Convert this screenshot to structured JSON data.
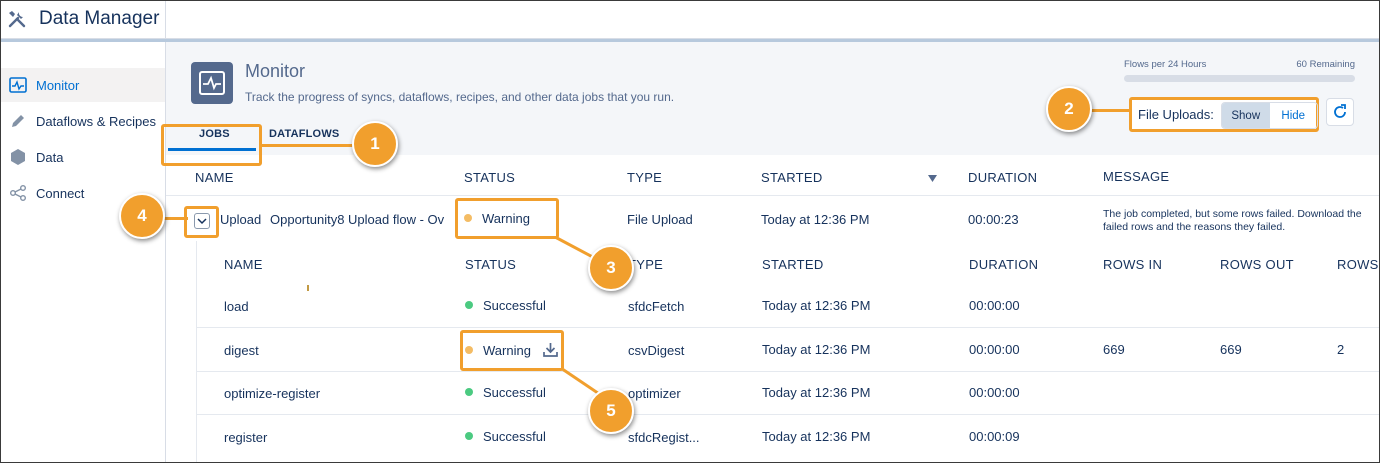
{
  "app": {
    "title": "Data Manager"
  },
  "sidebar": {
    "items": [
      {
        "label": "Monitor",
        "icon": "monitor-icon",
        "active": true
      },
      {
        "label": "Dataflows & Recipes",
        "icon": "pencil-icon",
        "active": false
      },
      {
        "label": "Data",
        "icon": "hexagon-icon",
        "active": false
      },
      {
        "label": "Connect",
        "icon": "share-icon",
        "active": false
      }
    ]
  },
  "header": {
    "title": "Monitor",
    "description": "Track the progress of syncs, dataflows, recipes, and other data jobs that you run.",
    "flows_label": "Flows per 24 Hours",
    "flows_remaining": "60 Remaining",
    "file_uploads_label": "File Uploads:",
    "show_label": "Show",
    "hide_label": "Hide"
  },
  "tabs": [
    {
      "label": "JOBS",
      "active": true
    },
    {
      "label": "DATAFLOWS",
      "active": false
    }
  ],
  "table": {
    "columns": [
      "NAME",
      "STATUS",
      "TYPE",
      "STARTED",
      "DURATION",
      "MESSAGE"
    ],
    "job": {
      "type_label": "Upload",
      "name": "Opportunity8 Upload flow - Ov",
      "status": "Warning",
      "type": "File Upload",
      "started": "Today at 12:36 PM",
      "duration": "00:00:23",
      "message_line1": "The job completed, but some rows failed. Download the",
      "message_line2": "failed rows and the reasons they failed."
    }
  },
  "subtable": {
    "columns": [
      "NAME",
      "STATUS",
      "TYPE",
      "STARTED",
      "DURATION",
      "ROWS IN",
      "ROWS OUT",
      "ROWS"
    ],
    "rows": [
      {
        "name": "load",
        "status": "Successful",
        "type": "sfdcFetch",
        "started": "Today at 12:36 PM",
        "duration": "00:00:00",
        "rows_in": "",
        "rows_out": "",
        "rows": ""
      },
      {
        "name": "digest",
        "status": "Warning",
        "type": "csvDigest",
        "started": "Today at 12:36 PM",
        "duration": "00:00:00",
        "rows_in": "669",
        "rows_out": "669",
        "rows": "2"
      },
      {
        "name": "optimize-register",
        "status": "Successful",
        "type": "optimizer",
        "started": "Today at 12:36 PM",
        "duration": "00:00:00",
        "rows_in": "",
        "rows_out": "",
        "rows": ""
      },
      {
        "name": "register",
        "status": "Successful",
        "type": "sfdcRegist...",
        "started": "Today at 12:36 PM",
        "duration": "00:00:09",
        "rows_in": "",
        "rows_out": "",
        "rows": ""
      }
    ]
  },
  "callouts": [
    "1",
    "2",
    "3",
    "4",
    "5"
  ],
  "colors": {
    "accent": "#f19f2d",
    "brand_blue": "#0070d2",
    "success": "#4bca81",
    "warning": "#f4bc64"
  }
}
